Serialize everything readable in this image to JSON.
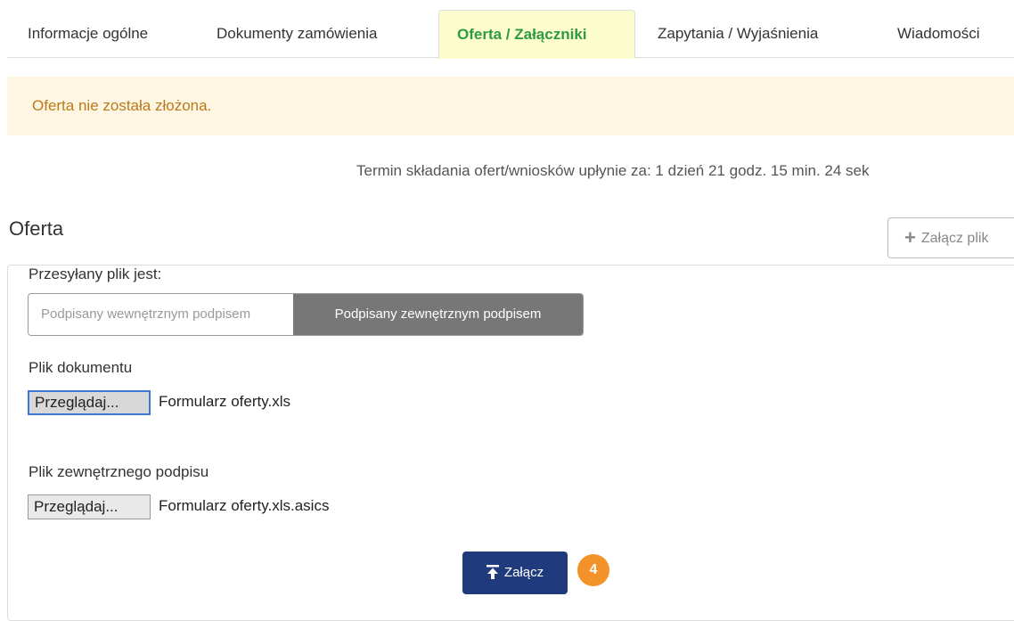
{
  "tabs": [
    {
      "label": "Informacje ogólne",
      "active": false
    },
    {
      "label": "Dokumenty zamówienia",
      "active": false
    },
    {
      "label": "Oferta / Załączniki",
      "active": true
    },
    {
      "label": "Zapytania / Wyjaśnienia",
      "active": false
    },
    {
      "label": "Wiadomości",
      "active": false
    }
  ],
  "alert": {
    "text": "Oferta nie została złożona."
  },
  "deadline": {
    "text": "Termin składania ofert/wniosków upłynie za: 1 dzień 21 godz. 15 min. 24 sek"
  },
  "section": {
    "title": "Oferta",
    "attach_label": "Załącz plik",
    "attach_icon": "plus-icon"
  },
  "form": {
    "file_type_label": "Przesyłany plik jest:",
    "file_type_options": [
      "Podpisany wewnętrznym podpisem",
      "Podpisany zewnętrznym podpisem"
    ],
    "file_type_selected": "Podpisany zewnętrznym podpisem",
    "document_label": "Plik dokumentu",
    "document_browse": "Przeglądaj...",
    "document_file": "Formularz oferty.xls",
    "signature_label": "Plik zewnętrznego podpisu",
    "signature_browse": "Przeglądaj...",
    "signature_file": "Formularz oferty.xls.asics",
    "submit_label": "Załącz",
    "submit_icon": "upload-icon",
    "step_badge": "4"
  },
  "colors": {
    "active_tab_bg": "#fcfccc",
    "active_tab_text": "#2f9a46",
    "alert_bg": "#fef5e3",
    "alert_text": "#b97a18",
    "submit_bg": "#1f3a7d",
    "step_badge_bg": "#f4922a"
  }
}
